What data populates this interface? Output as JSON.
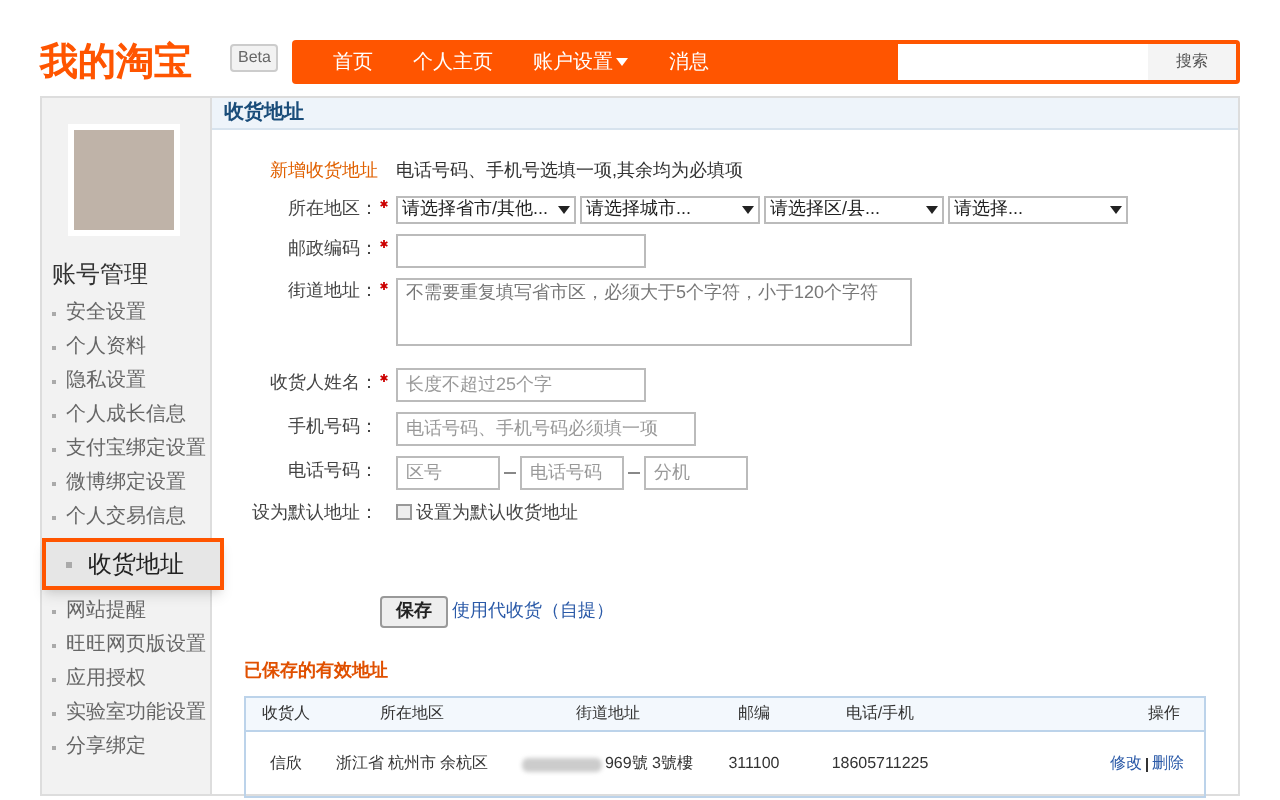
{
  "header": {
    "logo": "我的淘宝",
    "badge": "Beta",
    "nav": [
      {
        "label": "首页",
        "dropdown": false
      },
      {
        "label": "个人主页",
        "dropdown": false
      },
      {
        "label": "账户设置",
        "dropdown": true
      },
      {
        "label": "消息",
        "dropdown": false
      }
    ],
    "search_button": "搜索"
  },
  "sidebar": {
    "title": "账号管理",
    "items": [
      {
        "label": "安全设置",
        "selected": false
      },
      {
        "label": "个人资料",
        "selected": false
      },
      {
        "label": "隐私设置",
        "selected": false
      },
      {
        "label": "个人成长信息",
        "selected": false
      },
      {
        "label": "支付宝绑定设置",
        "selected": false
      },
      {
        "label": "微博绑定设置",
        "selected": false
      },
      {
        "label": "个人交易信息",
        "selected": false
      },
      {
        "label": "收货地址",
        "selected": true
      },
      {
        "label": "网站提醒",
        "selected": false
      },
      {
        "label": "旺旺网页版设置",
        "selected": false
      },
      {
        "label": "应用授权",
        "selected": false
      },
      {
        "label": "实验室功能设置",
        "selected": false
      },
      {
        "label": "分享绑定",
        "selected": false
      }
    ]
  },
  "panel_title": "收货地址",
  "form": {
    "heading": "新增收货地址",
    "note": "电话号码、手机号选填一项,其余均为必填项",
    "region": {
      "label": "所在地区：",
      "required": true,
      "selects": [
        "请选择省市/其他...",
        "请选择城市...",
        "请选择区/县...",
        "请选择..."
      ]
    },
    "postal": {
      "label": "邮政编码：",
      "required": true
    },
    "street": {
      "label": "街道地址：",
      "required": true,
      "placeholder": "不需要重复填写省市区，必须大于5个字符，小于120个字符"
    },
    "name": {
      "label": "收货人姓名：",
      "required": true,
      "placeholder": "长度不超过25个字"
    },
    "mobile": {
      "label": "手机号码：",
      "required": false,
      "placeholder": "电话号码、手机号码必须填一项"
    },
    "phone": {
      "label": "电话号码：",
      "required": false,
      "parts": [
        {
          "placeholder": "区号"
        },
        {
          "placeholder": "电话号码"
        },
        {
          "placeholder": "分机"
        }
      ]
    },
    "default": {
      "label": "设为默认地址：",
      "checkbox": "设置为默认收货地址",
      "checked": false
    },
    "save": "保存",
    "pickup_link": "使用代收货（自提）"
  },
  "saved": {
    "title": "已保存的有效地址",
    "columns": [
      "收货人",
      "所在地区",
      "街道地址",
      "邮编",
      "电话/手机",
      "操作"
    ],
    "rows": [
      {
        "name": "信欣",
        "region": "浙江省 杭州市 余杭区",
        "street": "969號 3號樓",
        "zip": "311100",
        "phone": "18605711225",
        "actions": [
          "修改",
          "删除"
        ]
      }
    ]
  }
}
